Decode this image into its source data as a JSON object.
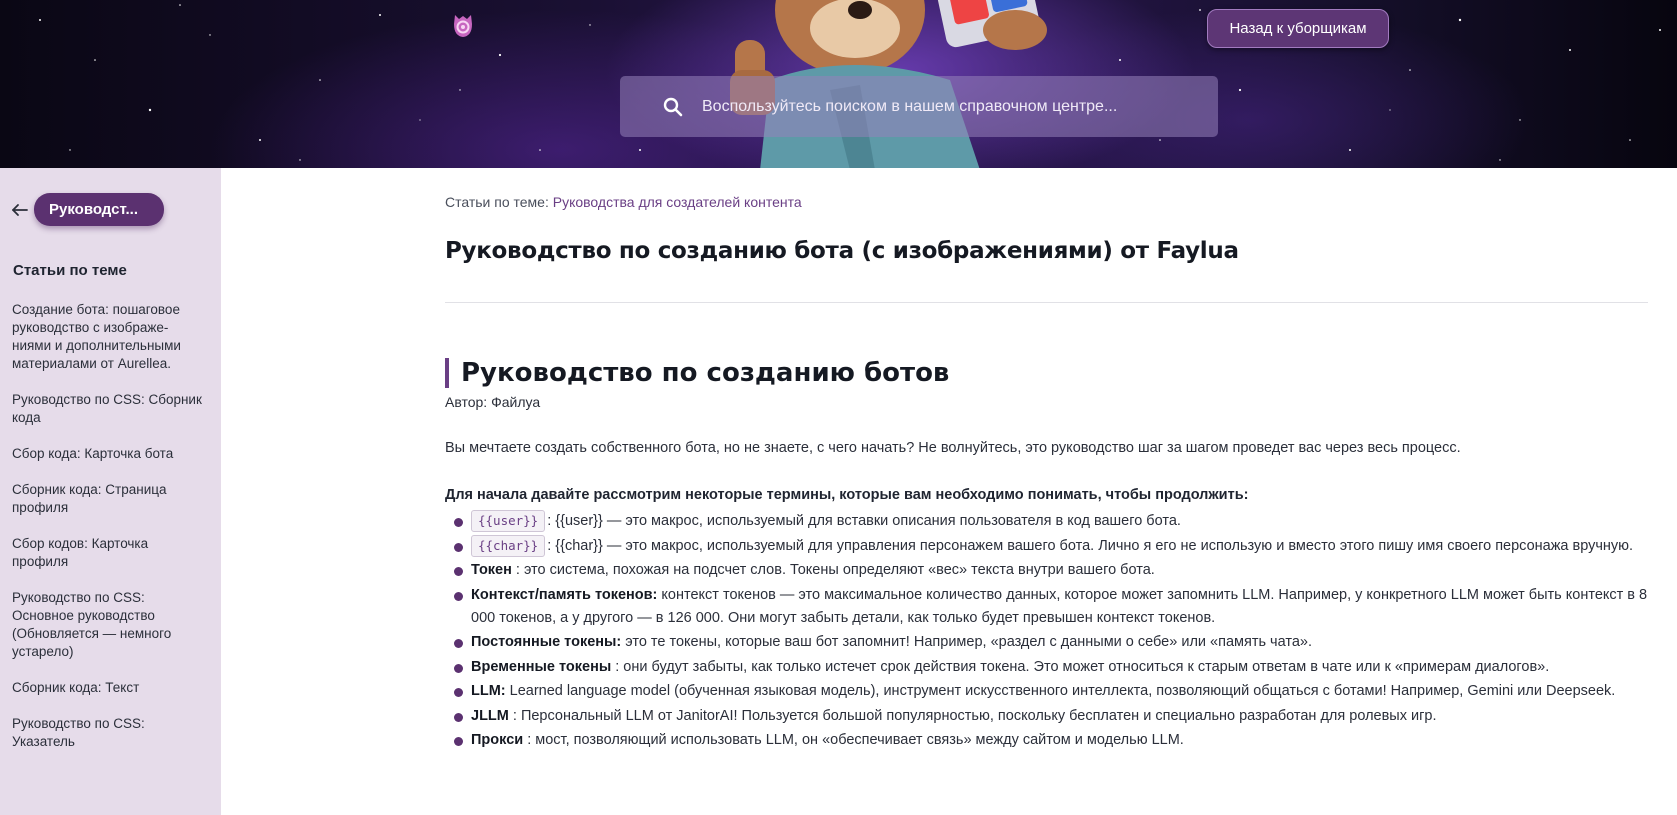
{
  "header": {
    "back_label": "Назад к уборщикам",
    "search_placeholder": "Воспользуйтесь поиском в нашем справочном центре..."
  },
  "sidebar": {
    "category_pill": "Руководст...",
    "heading": "Статьи по теме",
    "items": [
      {
        "label": "Создание бота: пошаговое руководство с изображе-ниями и дополнительными материалами от Aurellea."
      },
      {
        "label": "Руководство по CSS: Сборник кода"
      },
      {
        "label": "Сбор кода: Карточка бота"
      },
      {
        "label": "Сборник кода: Страница профиля"
      },
      {
        "label": "Сбор кодов: Карточка профиля"
      },
      {
        "label": "Руководство по CSS: Основное руководство (Обновляется — немного устарело)"
      },
      {
        "label": "Сборник кода: Текст"
      },
      {
        "label": "Руководство по CSS: Указатель"
      }
    ]
  },
  "article": {
    "breadcrumb_prefix": "Статьи по теме: ",
    "breadcrumb_link": "Руководства для создателей контента",
    "title": "Руководство по созданию бота (с изображениями) от Faylua",
    "section_heading": "Руководство по созданию ботов",
    "author": "Автор: Файлуа",
    "intro": "Вы мечтаете создать собственного бота, но не знаете, с чего начать? Не волнуйтесь, это руководство шаг за шагом проведет вас через весь процесс.",
    "terms_lead": "Для начала давайте рассмотрим некоторые термины, которые вам необходимо понимать, чтобы продолжить:",
    "terms": [
      {
        "code": "{{user}}",
        "term": "",
        "text": ": {{user}} — это макрос, используемый для вставки описания пользователя в код вашего бота."
      },
      {
        "code": "{{char}}",
        "term": "",
        "text": ": {{char}} — это макрос, используемый для управления персонажем вашего бота. Лично я его не использую и вместо этого пишу имя своего персонажа вручную."
      },
      {
        "code": "",
        "term": "Токен",
        "text": " : это система, похожая на подсчет слов. Токены определяют «вес» текста внутри вашего бота."
      },
      {
        "code": "",
        "term": "Контекст/память токенов:",
        "text": " контекст токенов — это максимальное количество данных, которое может запомнить LLM. Например, у конкретного LLM может быть контекст в 8 000 токенов, а у другого — в 126 000. Они могут забыть детали, как только будет превышен контекст токенов."
      },
      {
        "code": "",
        "term": "Постоянные токены:",
        "text": " это те токены, которые ваш бот запомнит! Например, «раздел с данными о себе» или «память чата»."
      },
      {
        "code": "",
        "term": "Временные токены",
        "text": " : они будут забыты, как только истечет срок действия токена. Это может относиться к старым ответам в чате или к «примерам диалогов»."
      },
      {
        "code": "",
        "term": "LLM:",
        "text": " Learned language model (обученная языковая модель), инструмент искусственного интеллекта, позволяющий общаться с ботами! Например, Gemini или Deepseek."
      },
      {
        "code": "",
        "term": "JLLM",
        "text": " : Персональный LLM от JanitorAI! Пользуется большой популярностью, поскольку бесплатен и специально разработан для ролевых игр."
      },
      {
        "code": "",
        "term": "Прокси",
        "text": " : мост, позволяющий использовать LLM, он «обеспечивает связь» между сайтом и моделью LLM."
      }
    ]
  },
  "colors": {
    "accent": "#5b3170",
    "sidebar_bg": "#e6dcea",
    "link": "#6a3f85"
  }
}
